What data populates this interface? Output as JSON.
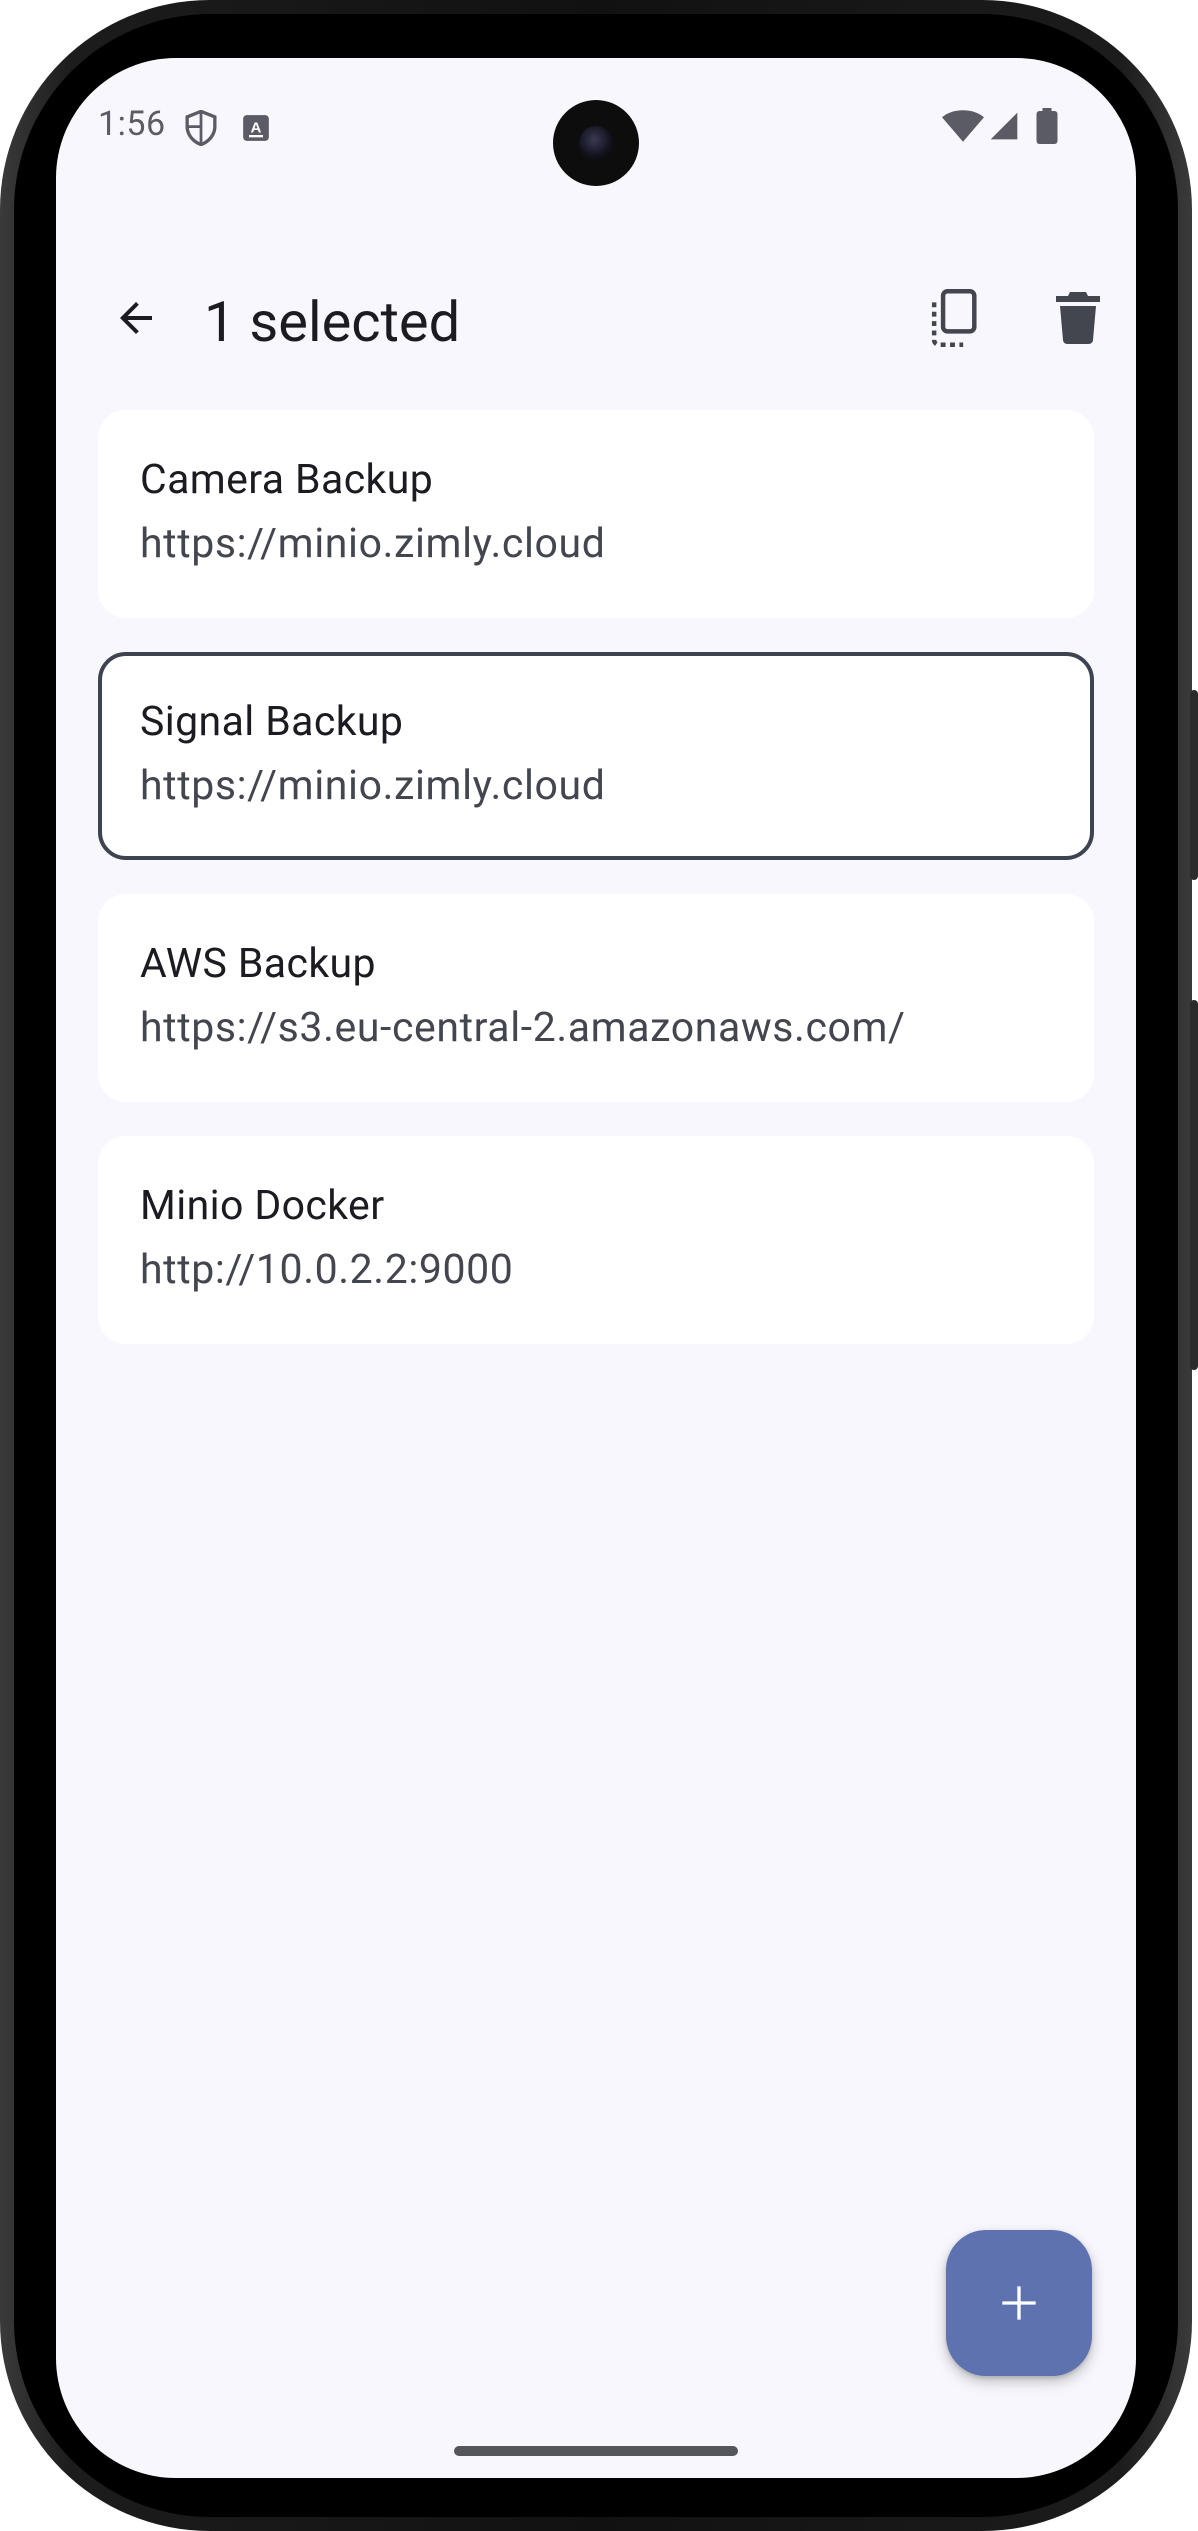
{
  "status_bar": {
    "time": "1:56",
    "left_icons": [
      "shield-icon",
      "keyboard-a-icon"
    ],
    "right_icons": [
      "wifi-icon",
      "cell-signal-icon",
      "battery-icon"
    ]
  },
  "app_bar": {
    "title": "1 selected",
    "back_icon": "arrow-back-icon",
    "actions": [
      "copy-icon",
      "delete-icon"
    ]
  },
  "connections": [
    {
      "name": "Camera Backup",
      "url": "https://minio.zimly.cloud",
      "selected": false
    },
    {
      "name": "Signal Backup",
      "url": "https://minio.zimly.cloud",
      "selected": true
    },
    {
      "name": "AWS Backup",
      "url": "https://s3.eu-central-2.amazonaws.com/",
      "selected": false
    },
    {
      "name": "Minio Docker",
      "url": "http://10.0.2.2:9000",
      "selected": false
    }
  ],
  "fab": {
    "icon": "plus-icon"
  },
  "colors": {
    "background": "#f8f7fd",
    "card": "#ffffff",
    "selected_border": "#3d4350",
    "fab": "#5e72b0",
    "text_primary": "#1b1b21",
    "text_secondary": "#44464f"
  }
}
